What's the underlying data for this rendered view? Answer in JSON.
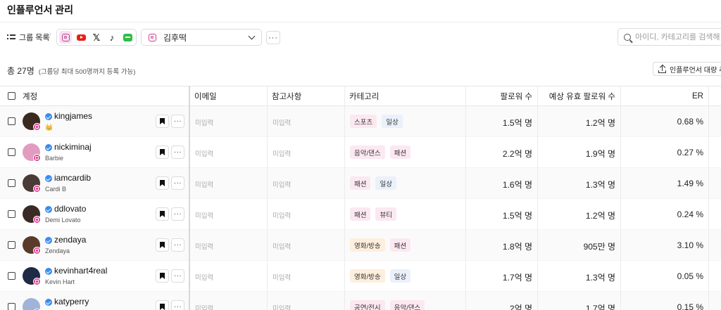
{
  "page": {
    "title": "인플루언서 관리"
  },
  "toolbar": {
    "group_list_label": "그룹 목록",
    "separator": "/",
    "platforms": [
      {
        "icon": "instagram-icon",
        "active": true
      },
      {
        "icon": "youtube-icon",
        "active": false
      },
      {
        "icon": "x-icon",
        "active": false
      },
      {
        "icon": "tiktok-icon",
        "active": false
      },
      {
        "icon": "line-icon",
        "active": false
      }
    ],
    "selected_account": "김후떡",
    "more_label": "···",
    "search_placeholder": "아이디, 카테고리를 검색해 보세요"
  },
  "summary": {
    "total": "총 27명",
    "limit_note": "(그룹당 최대 500명까지 등록 가능)",
    "bulk_add_label": "인플루언서 대량 추가"
  },
  "columns": {
    "account": "계정",
    "email": "이메일",
    "notes": "참고사항",
    "category": "카테고리",
    "followers": "팔로워 수",
    "est_valid_followers": "예상 유효 팔로워 수",
    "er": "ER"
  },
  "empty_value": "미입력",
  "colors": {
    "verified": "#3a8bf0",
    "instagram": "#e04593",
    "tag_pink": "#fce8f1",
    "tag_blue": "#eaf1fb",
    "tag_orange": "#fdeede"
  },
  "rows": [
    {
      "username": "kingjames",
      "display_name": "👑",
      "avatar": "#3b2a20",
      "categories": [
        {
          "label": "스포츠",
          "color": "#fce8f1"
        },
        {
          "label": "일상",
          "color": "#eaf1fb"
        }
      ],
      "email": "미입력",
      "notes": "미입력",
      "followers": "1.5억 명",
      "est_valid": "1.2억 명",
      "er": "0.68 %"
    },
    {
      "username": "nickiminaj",
      "display_name": "Barbie",
      "avatar": "#e29cc0",
      "categories": [
        {
          "label": "음악/댄스",
          "color": "#fce8f1"
        },
        {
          "label": "패션",
          "color": "#fce8f1"
        }
      ],
      "email": "미입력",
      "notes": "미입력",
      "followers": "2.2억 명",
      "est_valid": "1.9억 명",
      "er": "0.27 %"
    },
    {
      "username": "iamcardib",
      "display_name": "Cardi B",
      "avatar": "#4a3b36",
      "categories": [
        {
          "label": "패션",
          "color": "#fce8f1"
        },
        {
          "label": "일상",
          "color": "#eaf1fb"
        }
      ],
      "email": "미입력",
      "notes": "미입력",
      "followers": "1.6억 명",
      "est_valid": "1.3억 명",
      "er": "1.49 %"
    },
    {
      "username": "ddlovato",
      "display_name": "Demi Lovato",
      "avatar": "#3a2a26",
      "categories": [
        {
          "label": "패션",
          "color": "#fce8f1"
        },
        {
          "label": "뷰티",
          "color": "#fce8f1"
        }
      ],
      "email": "미입력",
      "notes": "미입력",
      "followers": "1.5억 명",
      "est_valid": "1.2억 명",
      "er": "0.24 %"
    },
    {
      "username": "zendaya",
      "display_name": "Zendaya",
      "avatar": "#5a3a2a",
      "categories": [
        {
          "label": "영화/방송",
          "color": "#fdeede"
        },
        {
          "label": "패션",
          "color": "#fce8f1"
        }
      ],
      "email": "미입력",
      "notes": "미입력",
      "followers": "1.8억 명",
      "est_valid": "905만 명",
      "er": "3.10 %"
    },
    {
      "username": "kevinhart4real",
      "display_name": "Kevin Hart",
      "avatar": "#1f2a44",
      "categories": [
        {
          "label": "영화/방송",
          "color": "#fdeede"
        },
        {
          "label": "일상",
          "color": "#eaf1fb"
        }
      ],
      "email": "미입력",
      "notes": "미입력",
      "followers": "1.7억 명",
      "est_valid": "1.3억 명",
      "er": "0.05 %"
    },
    {
      "username": "katyperry",
      "display_name": "",
      "avatar": "#9fb4d8",
      "categories": [
        {
          "label": "공연/전시",
          "color": "#fce8f1"
        },
        {
          "label": "음악/댄스",
          "color": "#fce8f1"
        }
      ],
      "email": "미입력",
      "notes": "미입력",
      "followers": "2억 명",
      "est_valid": "1.7억 명",
      "er": "0.15 %"
    }
  ]
}
